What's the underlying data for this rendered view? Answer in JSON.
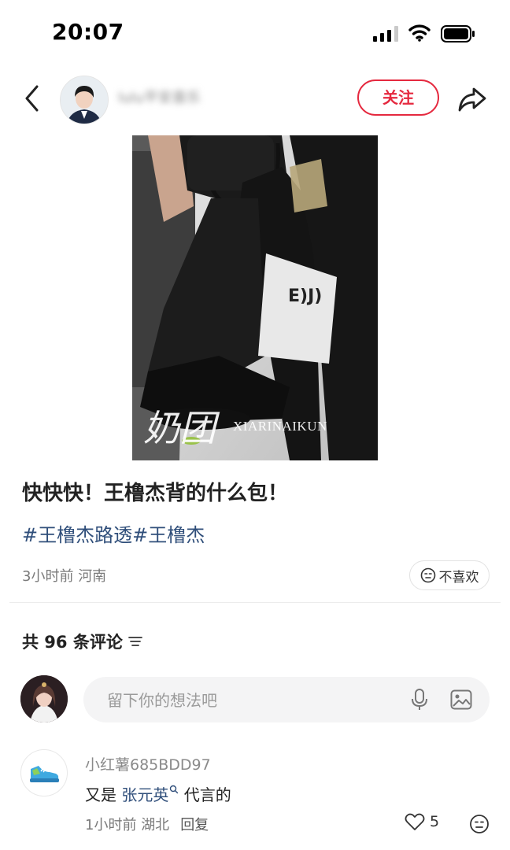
{
  "status_bar": {
    "time": "20:07"
  },
  "header": {
    "username": "lulu平安喜乐",
    "follow_label": "关注"
  },
  "media": {
    "watermark_cn": "奶团",
    "watermark_en": "XIARINAIKUN",
    "bag_text": "E)J)"
  },
  "post": {
    "title": "快快快！王橹杰背的什么包！",
    "tags": [
      "#王橹杰路透",
      "#王橹杰"
    ],
    "time": "3小时前",
    "location": "河南",
    "dislike_label": "不喜欢"
  },
  "comments_header": {
    "label": "共 96 条评论"
  },
  "comment_input": {
    "placeholder": "留下你的想法吧"
  },
  "comments": [
    {
      "user": "小红薯685BDD97",
      "text_prefix": "又是 ",
      "mention": "张元英",
      "text_suffix": " 代言的",
      "time": "1小时前",
      "location": "湖北",
      "reply_label": "回复",
      "likes": "5"
    }
  ],
  "colors": {
    "accent": "#e5293f",
    "link": "#2f4e7a"
  }
}
